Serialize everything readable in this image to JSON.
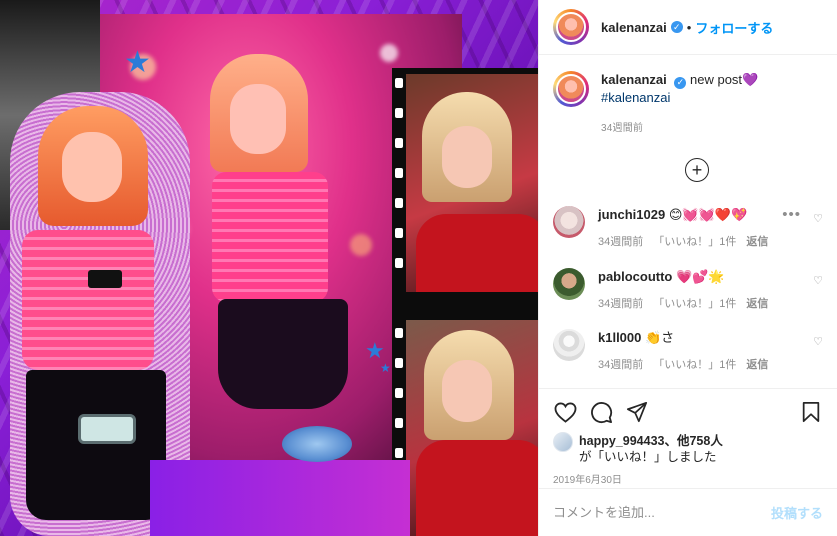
{
  "header": {
    "username": "kalenanzai",
    "follow_label": "フォローする"
  },
  "caption": {
    "username": "kalenanzai",
    "text": "new post💜",
    "hashtag": "#kalenanzai",
    "time": "34週間前"
  },
  "comments": [
    {
      "username": "junchi1029",
      "text": "😊💓💓❤️💖",
      "time": "34週間前",
      "likes": "「いいね！」1件",
      "reply": "返信"
    },
    {
      "username": "pablocoutto",
      "text": "💗💕🌟",
      "time": "34週間前",
      "likes": "「いいね！」1件",
      "reply": "返信"
    },
    {
      "username": "k1ll000",
      "text": "👏さ",
      "time": "34週間前",
      "likes": "「いいね！」1件",
      "reply": "返信"
    }
  ],
  "likes": {
    "line1": "happy_994433、他758人",
    "line2": "が「いいね！」しました"
  },
  "date": "2019年6月30日",
  "add_comment": {
    "placeholder": "コメントを追加...",
    "post_label": "投稿する"
  },
  "colors": {
    "accent": "#0095f6",
    "post_disabled": "#b2dffc",
    "muted": "#8e8e8e",
    "verified": "#3897f0"
  },
  "icons": {
    "more": "ellipsis-icon",
    "like": "heart-icon",
    "comment": "comment-icon",
    "share": "share-icon",
    "save": "bookmark-icon",
    "load_more": "plus-circle-icon"
  }
}
